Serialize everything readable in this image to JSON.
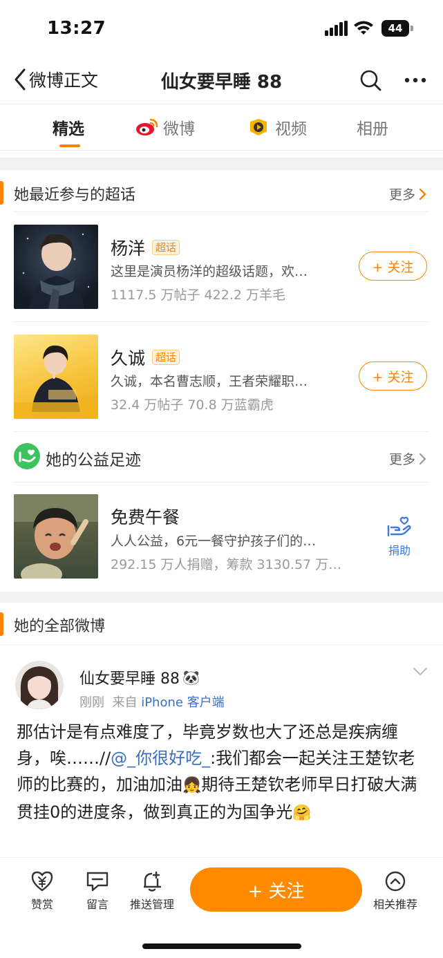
{
  "status": {
    "time": "13:27",
    "battery": "44"
  },
  "nav": {
    "back_label": "微博正文",
    "title": "仙女要早睡 88"
  },
  "tabs": [
    {
      "label": "精选"
    },
    {
      "label": "微博"
    },
    {
      "label": "视频"
    },
    {
      "label": "相册"
    }
  ],
  "supertopics": {
    "title": "她最近参与的超话",
    "more": "更多",
    "items": [
      {
        "name": "杨洋",
        "badge": "超话",
        "desc": "这里是演员杨洋的超级话题，欢…",
        "stats": "1117.5 万帖子 422.2 万羊毛",
        "follow": "+ 关注"
      },
      {
        "name": "久诚",
        "badge": "超话",
        "desc": "久诚，本名曹志顺，王者荣耀职…",
        "stats": "32.4 万帖子 70.8 万蓝霸虎",
        "follow": "+ 关注"
      }
    ]
  },
  "charity": {
    "title": "她的公益足迹",
    "more": "更多",
    "item": {
      "name": "免费午餐",
      "desc": "人人公益，6元一餐守护孩子们的…",
      "stats": "292.15 万人捐赠，筹款 3130.57 万…",
      "action": "捐助"
    }
  },
  "posts_section": {
    "title": "她的全部微博"
  },
  "post": {
    "user": "仙女要早睡 88",
    "time": "刚刚",
    "from_prefix": "来自",
    "source": "iPhone 客户端",
    "text_1": "那估计是有点难度了，毕竟岁数也大了还总是疾病缠身，唉……//",
    "mention": "@_你很好吃_",
    "text_2": ":我们都会一起关注王楚钦老师的比赛的，加油加油",
    "text_3": "期待王楚钦老师早日打破大满贯挂0的进度条，做到真正的为国争光"
  },
  "bottom": {
    "reward": "赞赏",
    "comment": "留言",
    "push": "推送管理",
    "follow": "+ 关注",
    "related": "相关推荐"
  },
  "colors": {
    "accent": "#ff8200",
    "link": "#3a6fc4",
    "donate": "#3a7ae0"
  }
}
